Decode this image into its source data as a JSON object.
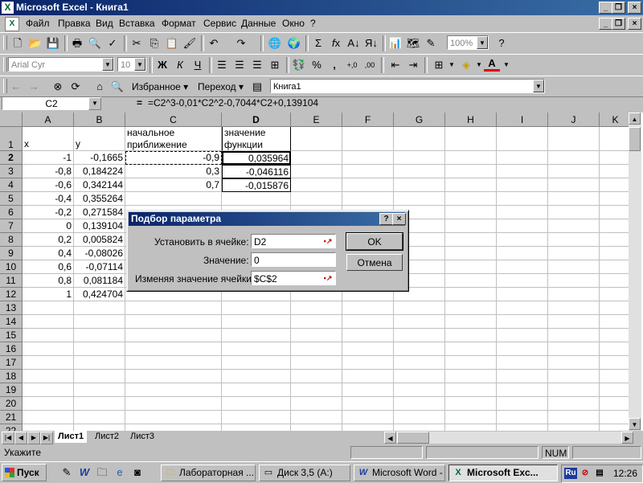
{
  "window": {
    "title": "Microsoft Excel - Книга1",
    "app_icon": "excel-icon",
    "controls": [
      "_",
      "❐",
      "×"
    ]
  },
  "menubar": {
    "items": [
      "Файл",
      "Правка",
      "Вид",
      "Вставка",
      "Формат",
      "Сервис",
      "Данные",
      "Окно",
      "?"
    ]
  },
  "toolbar_standard": {
    "zoom": "100%"
  },
  "toolbar_formatting": {
    "font_name": "Arial Cyr",
    "font_size": "10",
    "bold": "Ж",
    "italic": "К",
    "underline": "Ч",
    "percent": "%",
    "comma": ",",
    "inc_decimal": "+,0",
    "dec_decimal": ",00"
  },
  "toolbar_web": {
    "favorites": "Избранное ▾",
    "goto": "Переход ▾",
    "address": "Книга1"
  },
  "formula_bar": {
    "name_box": "C2",
    "equals": "=",
    "formula": "=C2^3-0,01*C2^2-0,7044*C2+0,139104"
  },
  "grid": {
    "columns": [
      "A",
      "B",
      "C",
      "D",
      "E",
      "F",
      "G",
      "H",
      "I",
      "J",
      "K"
    ],
    "active_column": "D",
    "rows": [
      "1",
      "2",
      "3",
      "4",
      "5",
      "6",
      "7",
      "8",
      "9",
      "10",
      "11",
      "12",
      "13",
      "14",
      "15",
      "16",
      "17",
      "18",
      "19",
      "20",
      "21",
      "22"
    ],
    "active_row": "2",
    "headers_row1": {
      "A": "x",
      "B": "y",
      "C": "начальное приближение",
      "D": "значение функции"
    },
    "cells": {
      "A": [
        "-1",
        "-0,8",
        "-0,6",
        "-0,4",
        "-0,2",
        "0",
        "0,2",
        "0,4",
        "0,6",
        "0,8",
        "1"
      ],
      "B": [
        "-0,1665",
        "0,184224",
        "0,342144",
        "0,355264",
        "0,271584",
        "0,139104",
        "0,005824",
        "-0,08026",
        "-0,07114",
        "0,081184",
        "0,424704"
      ],
      "C": [
        "-0,9",
        "0,3",
        "0,7"
      ],
      "D": [
        "0,035964",
        "-0,046116",
        "-0,015876"
      ]
    }
  },
  "dialog": {
    "title": "Подбор параметра",
    "help": "?",
    "close": "×",
    "set_cell_label": "Установить в ячейке:",
    "set_cell_value": "D2",
    "value_label": "Значение:",
    "value_value": "0",
    "changing_cell_label": "Изменяя значение ячейки:",
    "changing_cell_value": "$C$2",
    "ok": "OK",
    "cancel": "Отмена"
  },
  "sheet_tabs": {
    "tabs": [
      "Лист1",
      "Лист2",
      "Лист3"
    ],
    "active": "Лист1"
  },
  "status_bar": {
    "mode": "Укажите",
    "num": "NUM"
  },
  "taskbar": {
    "start": "Пуск",
    "tasks": [
      {
        "label": "Лабораторная ...",
        "icon": "folder-icon"
      },
      {
        "label": "Диск 3,5 (A:)",
        "icon": "drive-icon"
      },
      {
        "label": "Microsoft Word - ...",
        "icon": "word-icon"
      },
      {
        "label": "Microsoft Exc...",
        "icon": "excel-icon"
      }
    ],
    "lang": "Ru",
    "clock": "12:26"
  }
}
